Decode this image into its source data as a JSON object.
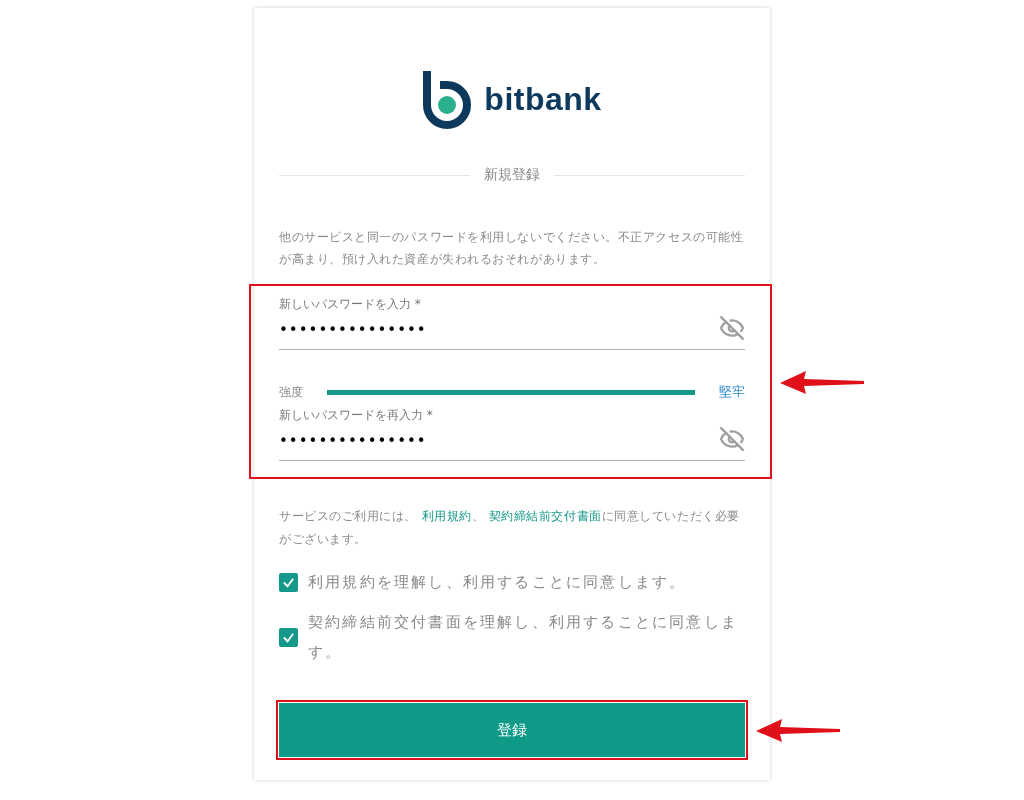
{
  "logo": {
    "text": "bitbank"
  },
  "heading": "新規登録",
  "notice": "他のサービスと同一のパスワードを利用しないでください。不正アクセスの可能性が高まり、預け入れた資産が失われるおそれがあります。",
  "password_section": {
    "highlighted": true,
    "fields": [
      {
        "label": "新しいパスワードを入力 *",
        "value": "•••••••••••••••",
        "masked": true
      },
      {
        "label": "新しいパスワードを再入力 *",
        "value": "•••••••••••••••",
        "masked": true
      }
    ],
    "strength": {
      "label": "強度",
      "level": 1,
      "reading": "堅牢"
    }
  },
  "terms_notice": [
    {
      "kind": "text",
      "text": "サービスのご利用には、 "
    },
    {
      "kind": "link",
      "text": "利用規約"
    },
    {
      "kind": "text",
      "text": "、 "
    },
    {
      "kind": "link",
      "text": "契約締結前交付書面"
    },
    {
      "kind": "text",
      "text": "に同意していただく必要がございます。"
    }
  ],
  "agreements": [
    {
      "label": "利用規約を理解し、利用することに同意します。",
      "checked": true
    },
    {
      "label": "契約締結前交付書面を理解し、利用することに同意します。",
      "checked": true
    }
  ],
  "submit": {
    "label": "登録",
    "highlighted": true
  }
}
